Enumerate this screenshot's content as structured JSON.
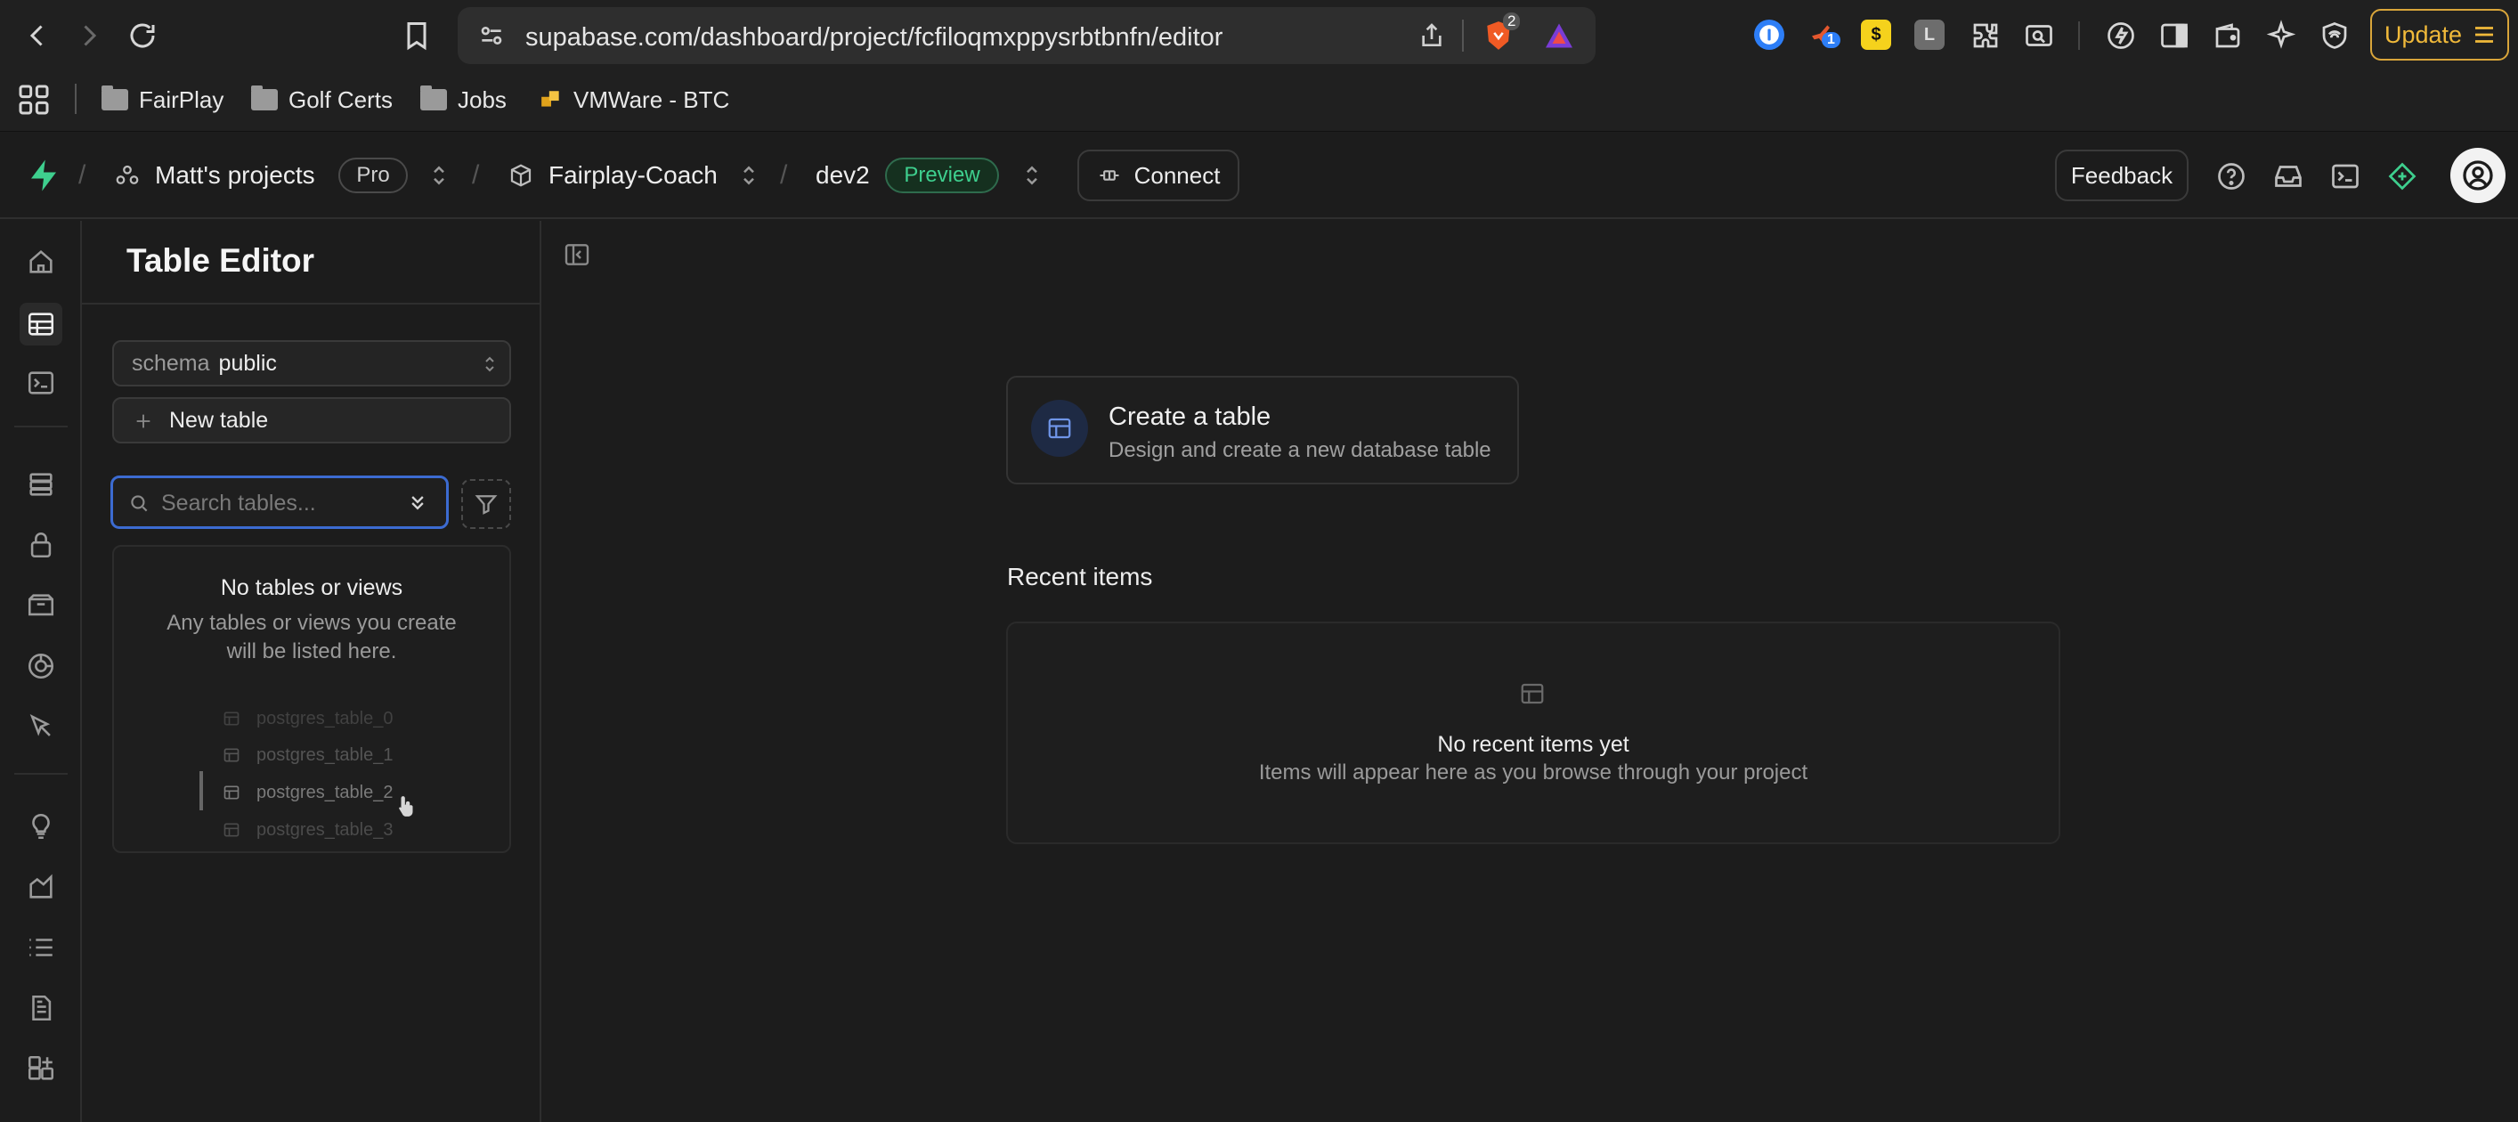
{
  "browser": {
    "url": "supabase.com/dashboard/project/fcfiloqmxppysrbtbnfn/editor",
    "brave_badge": "2",
    "ext_badge": "1",
    "ext_letter": "L",
    "update_label": "Update",
    "bookmarks": [
      {
        "label": "FairPlay"
      },
      {
        "label": "Golf Certs"
      },
      {
        "label": "Jobs"
      },
      {
        "label": "VMWare - BTC"
      }
    ]
  },
  "header": {
    "org": "Matt's projects",
    "plan": "Pro",
    "project": "Fairplay-Coach",
    "branch": "dev2",
    "branch_badge": "Preview",
    "connect_label": "Connect",
    "feedback_label": "Feedback",
    "accent": "#3ecf8e"
  },
  "panel": {
    "title": "Table Editor",
    "schema_key": "schema",
    "schema_value": "public",
    "new_table_label": "New table",
    "search_placeholder": "Search tables...",
    "empty_title": "No tables or views",
    "empty_desc": "Any tables or views you create will be listed here.",
    "ghost_tables": [
      "postgres_table_0",
      "postgres_table_1",
      "postgres_table_2",
      "postgres_table_3"
    ]
  },
  "main": {
    "card_title": "Create a table",
    "card_desc": "Design and create a new database table",
    "recent_title": "Recent items",
    "recent_empty": "No recent items yet",
    "recent_desc": "Items will appear here as you browse through your project"
  }
}
